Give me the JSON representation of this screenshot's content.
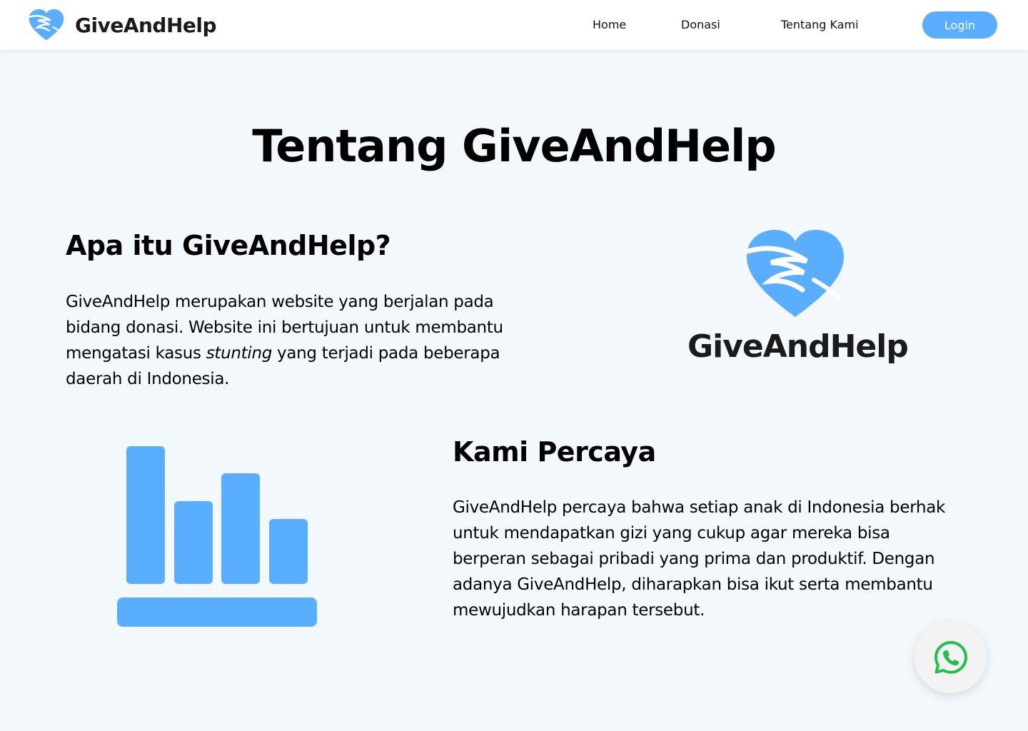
{
  "header": {
    "brand_name": "GiveAndHelp",
    "brand_logo_icon": "heart-hands-icon",
    "nav": {
      "home": "Home",
      "donasi": "Donasi",
      "tentang": "Tentang Kami"
    },
    "login_label": "Login"
  },
  "main": {
    "title": "Tentang GiveAndHelp",
    "section_about": {
      "heading": "Apa itu GiveAndHelp?",
      "text_before": "GiveAndHelp merupakan website yang berjalan pada bidang donasi. Website ini bertujuan untuk membantu mengatasi kasus ",
      "text_emphasis": "stunting",
      "text_after": " yang terjadi pada beberapa daerah di Indonesia."
    },
    "hero_logo": {
      "icon": "heart-hands-icon",
      "name": "GiveAndHelp"
    },
    "section_belief": {
      "illustration_icon": "bar-chart-icon",
      "heading": "Kami Percaya",
      "text": "GiveAndHelp percaya bahwa setiap anak di Indonesia berhak untuk mendapatkan gizi yang cukup agar mereka bisa berperan sebagai pribadi yang prima dan produktif. Dengan adanya GiveAndHelp, diharapkan bisa ikut serta membantu mewujudkan harapan tersebut."
    }
  },
  "floating": {
    "whatsapp_icon": "whatsapp-icon"
  },
  "colors": {
    "accent": "#5aaeff",
    "background": "#f3f8fd",
    "whatsapp_green": "#25c04a"
  }
}
